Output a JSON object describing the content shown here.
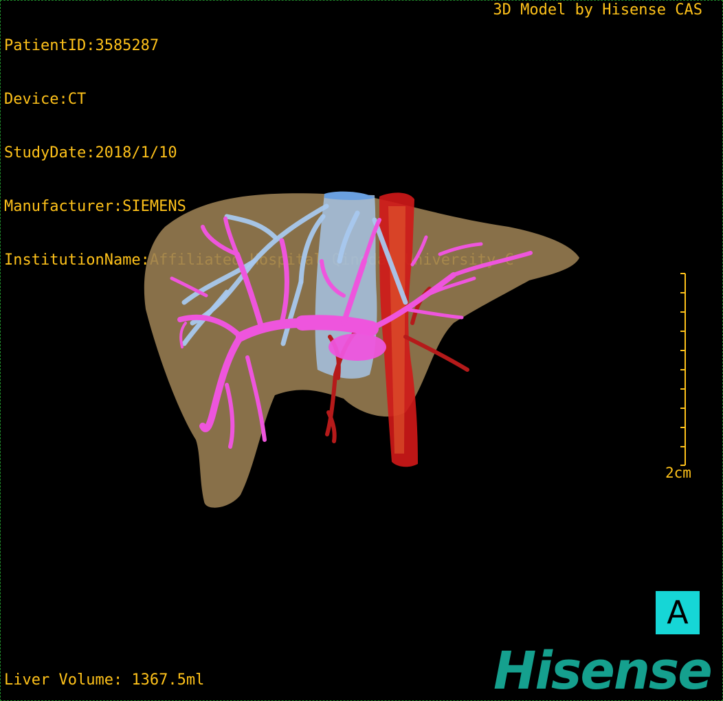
{
  "header": {
    "patient_id": "PatientID:3585287",
    "device": "Device:CT",
    "study_date": "StudyDate:2018/1/10",
    "manufacturer": "Manufacturer:SIEMENS",
    "institution": "InstitutionName:Affiliated Hospital Qingdao University-C",
    "model_credit": "3D Model by Hisense CAS"
  },
  "footer": {
    "liver_volume": "Liver Volume: 1367.5ml"
  },
  "scale_bar": {
    "label": "2cm"
  },
  "orientation": {
    "label": "A"
  },
  "logo": {
    "text": "Hisense",
    "color": "#15a08e"
  },
  "colors": {
    "text": "#ffc21a",
    "liver": "#9b8053",
    "portal_vein": "#ee55dd",
    "hepatic_vein": "#a8c8ee",
    "artery": "#d21818",
    "orientation_bg": "#16d6d6",
    "border": "#1f8a2a"
  },
  "model": {
    "structures": [
      "liver",
      "portal-vein",
      "hepatic-vein",
      "inferior-vena-cava",
      "aorta",
      "hepatic-artery"
    ]
  }
}
